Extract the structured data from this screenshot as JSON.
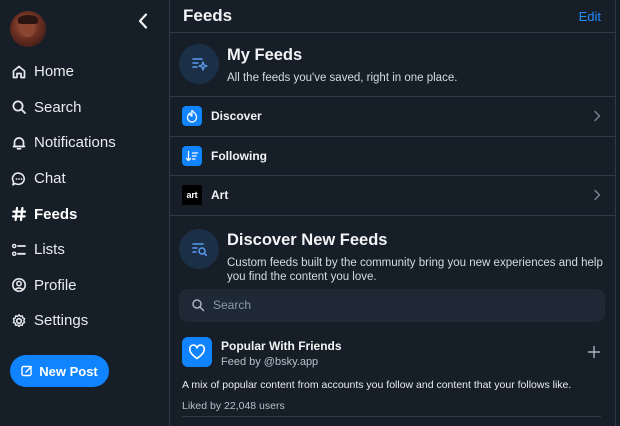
{
  "sidebar": {
    "nav": [
      {
        "label": "Home",
        "icon": "home-icon"
      },
      {
        "label": "Search",
        "icon": "search-icon"
      },
      {
        "label": "Notifications",
        "icon": "bell-icon"
      },
      {
        "label": "Chat",
        "icon": "chat-bubble-icon"
      },
      {
        "label": "Feeds",
        "icon": "hash-icon",
        "active": true
      },
      {
        "label": "Lists",
        "icon": "list-icon"
      },
      {
        "label": "Profile",
        "icon": "user-circle-icon"
      },
      {
        "label": "Settings",
        "icon": "gear-icon"
      }
    ],
    "new_post_label": "New Post"
  },
  "header": {
    "title": "Feeds",
    "edit_label": "Edit"
  },
  "my_feeds": {
    "title": "My Feeds",
    "subtitle": "All the feeds you've saved, right in one place.",
    "items": [
      {
        "name": "Discover",
        "icon": "discover-feed-icon",
        "has_chevron": true
      },
      {
        "name": "Following",
        "icon": "following-feed-icon",
        "has_chevron": false
      },
      {
        "name": "Art",
        "icon": "art-feed-icon",
        "icon_text": "art",
        "has_chevron": true
      }
    ]
  },
  "discover": {
    "title": "Discover New Feeds",
    "subtitle": "Custom feeds built by the community bring you new experiences and help you find the content you love.",
    "search_placeholder": "Search"
  },
  "feed_card": {
    "name": "Popular With Friends",
    "by": "Feed by @bsky.app",
    "description": "A mix of popular content from accounts you follow and content that your follows like.",
    "likes": "Liked by 22,048 users"
  },
  "colors": {
    "accent": "#1083fe",
    "link": "#208bfe",
    "background": "#161e27",
    "border": "#2e3a47"
  }
}
